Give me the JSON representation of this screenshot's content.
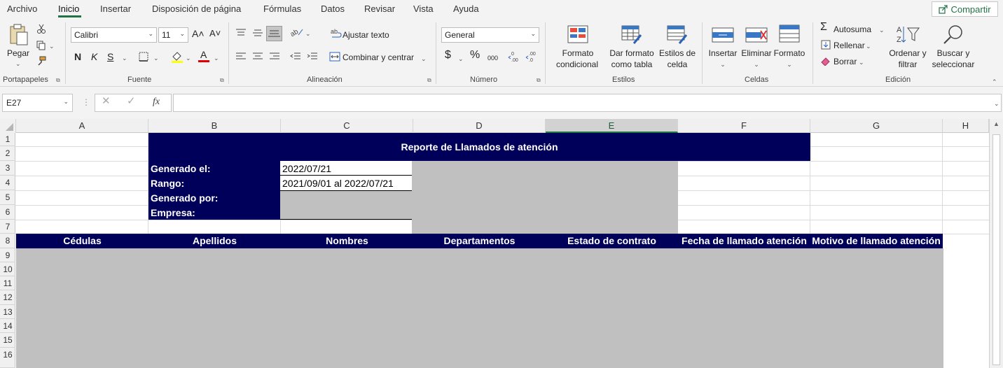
{
  "tabs": [
    "Archivo",
    "Inicio",
    "Insertar",
    "Disposición de página",
    "Fórmulas",
    "Datos",
    "Revisar",
    "Vista",
    "Ayuda"
  ],
  "share_label": "Compartir",
  "ribbon": {
    "paste": "Pegar",
    "font_name": "Calibri",
    "font_size": "11",
    "bold": "N",
    "italic": "K",
    "underline": "S",
    "wrap_text": "Ajustar texto",
    "merge_center": "Combinar y centrar",
    "number_format": "General",
    "currency": "$",
    "percent": "%",
    "thousands": "000",
    "cond_format_1": "Formato",
    "cond_format_2": "condicional",
    "format_table_1": "Dar formato",
    "format_table_2": "como tabla",
    "cell_styles_1": "Estilos de",
    "cell_styles_2": "celda",
    "insert": "Insertar",
    "delete": "Eliminar",
    "format": "Formato",
    "autosum": "Autosuma",
    "fill": "Rellenar",
    "clear": "Borrar",
    "sort_1": "Ordenar y",
    "sort_2": "filtrar",
    "find_1": "Buscar y",
    "find_2": "seleccionar",
    "groups": [
      "Portapapeles",
      "Fuente",
      "Alineación",
      "Número",
      "Estilos",
      "Celdas",
      "Edición"
    ]
  },
  "namebox": "E27",
  "fx": "fx",
  "columns": [
    "A",
    "B",
    "C",
    "D",
    "E",
    "F",
    "G",
    "H"
  ],
  "selected_column": "E",
  "rows": [
    "1",
    "2",
    "3",
    "4",
    "5",
    "6",
    "7",
    "8",
    "9",
    "10",
    "11",
    "12",
    "13",
    "14",
    "15",
    "16"
  ],
  "report": {
    "title": "Reporte de Llamados de atención",
    "generated_label": "Generado el:",
    "generated_value": "2022/07/21",
    "range_label": "Rango:",
    "range_value": "2021/09/01 al 2022/07/21",
    "generated_by_label": "Generado por:",
    "company_label": "Empresa:"
  },
  "table_headers": [
    "Cédulas",
    "Apellidos",
    "Nombres",
    "Departamentos",
    "Estado de contrato",
    "Fecha de llamado atención",
    "Motivo de llamado atención"
  ],
  "colors": {
    "navy": "#00005b",
    "grey": "#c0c0c0",
    "accent": "#217346"
  }
}
